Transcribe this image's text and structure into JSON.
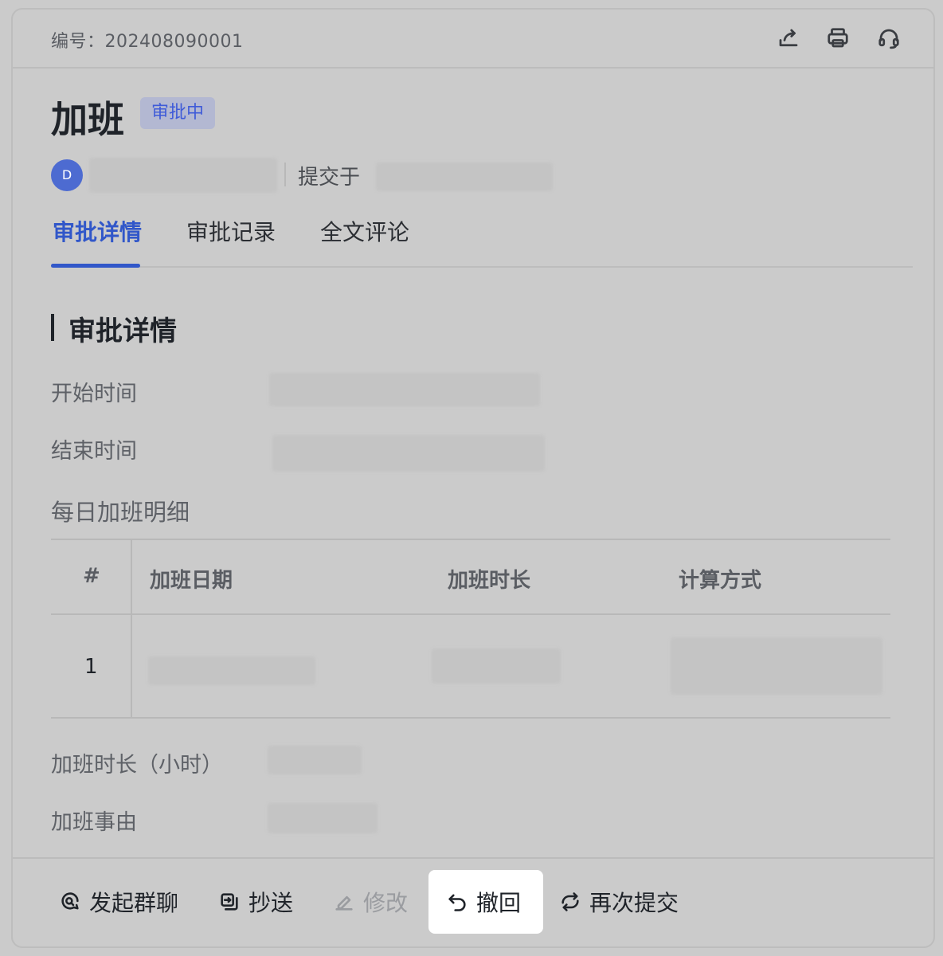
{
  "header": {
    "serial_label": "编号：202408090001",
    "icons": [
      "share-icon",
      "print-icon",
      "headset-icon"
    ]
  },
  "form": {
    "title": "加班",
    "status_badge": "审批中",
    "avatar_letter": "D",
    "submitted_label": "提交于"
  },
  "tabs": [
    {
      "label": "审批详情",
      "active": true
    },
    {
      "label": "审批记录",
      "active": false
    },
    {
      "label": "全文评论",
      "active": false
    }
  ],
  "details": {
    "section_title": "审批详情",
    "start_time_label": "开始时间",
    "end_time_label": "结束时间",
    "daily_detail_label": "每日加班明细",
    "table": {
      "headers": [
        "#",
        "加班日期",
        "加班时长",
        "计算方式"
      ],
      "rows": [
        {
          "index": "1"
        }
      ]
    },
    "hours_label": "加班时长（小时）",
    "reason_label": "加班事由"
  },
  "footer": {
    "group_chat": "发起群聊",
    "cc": "抄送",
    "edit": "修改",
    "revoke": "撤回",
    "resubmit": "再次提交"
  },
  "colors": {
    "accent": "#3157c9",
    "badge_text": "#3f5bd8",
    "avatar": "#4d6bd1"
  }
}
